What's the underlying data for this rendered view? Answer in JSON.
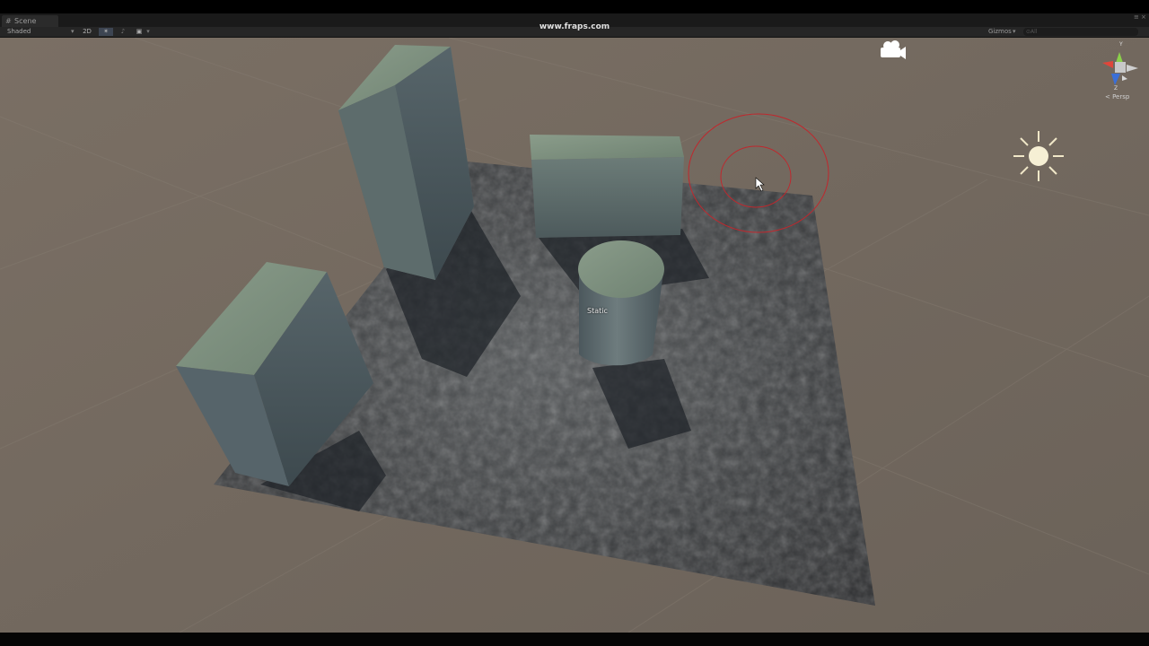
{
  "window": {
    "tab_icon": "scene-icon",
    "tab_label": "Scene",
    "window_controls": [
      "≡",
      "×"
    ]
  },
  "toolbar": {
    "shading_mode": "Shaded",
    "mode_2d": "2D",
    "lighting_icon": "sun-toggle-icon",
    "audio_icon": "audio-icon",
    "effects_icon": "image-effects-icon",
    "gizmos_label": "Gizmos",
    "search_placeholder": "⊙All"
  },
  "overlay": {
    "watermark": "www.fraps.com"
  },
  "scene": {
    "object_label": "Static",
    "camera_icon": "camera-icon",
    "light_icon": "directional-light-icon",
    "brush_color": "#c0272d"
  },
  "orientation_gizmo": {
    "y_label": "Y",
    "z_label": "Z",
    "projection_label": "< Persp"
  }
}
